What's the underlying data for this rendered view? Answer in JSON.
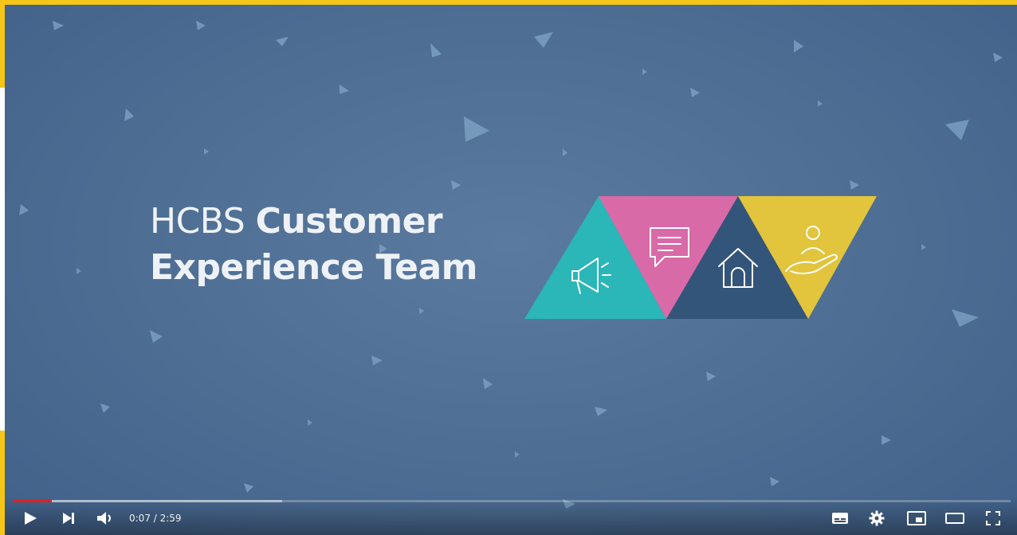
{
  "video": {
    "title_light": "HCBS",
    "title_bold_1": "Customer",
    "title_bold_2": "Experience Team",
    "icons": [
      "megaphone-icon",
      "chat-bubble-icon",
      "house-icon",
      "helping-hand-icon"
    ],
    "colors": {
      "background": "#4f6f95",
      "teal": "#2bb6b8",
      "pink": "#d96aa8",
      "navy": "#34557a",
      "yellow": "#e2c43d",
      "frame": "#F5C518"
    }
  },
  "player": {
    "current_time": "0:07",
    "duration": "2:59",
    "time_display": "0:07 / 2:59",
    "progress_fraction": 0.039,
    "buffered_fraction": 0.27,
    "progress_color": "#e02020",
    "controls": {
      "left": [
        "play-icon",
        "next-icon",
        "volume-icon"
      ],
      "right": [
        "subtitles-icon",
        "settings-icon",
        "miniplayer-icon",
        "theater-mode-icon",
        "fullscreen-icon"
      ]
    }
  }
}
